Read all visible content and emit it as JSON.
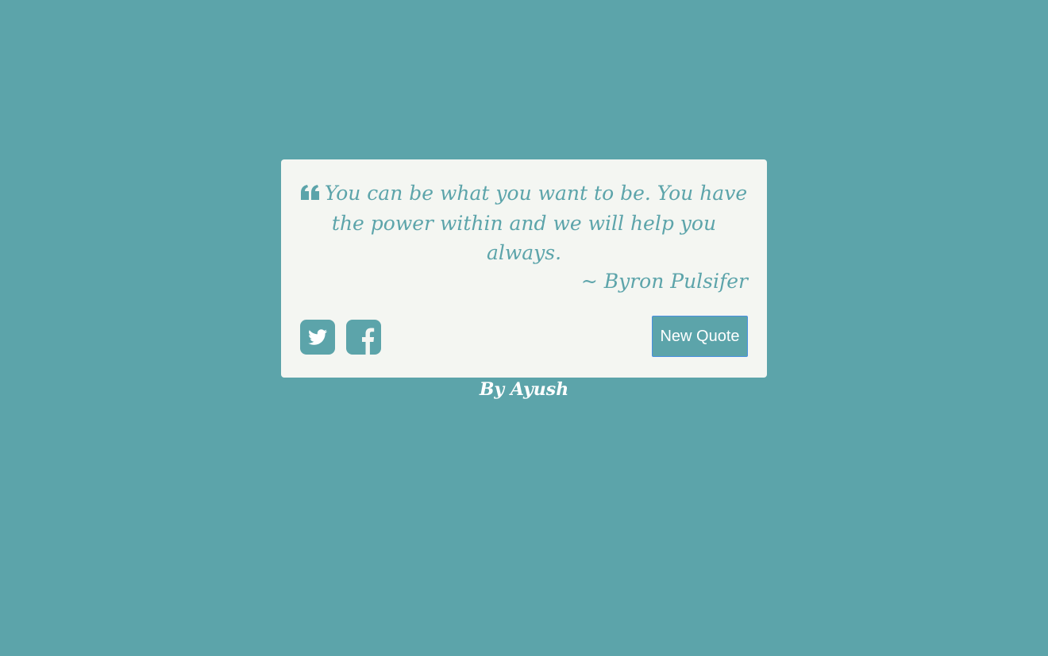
{
  "colors": {
    "background": "#5ca4aa",
    "card": "#f4f6f2",
    "accent": "#5ca4aa",
    "button_text": "#ffffff"
  },
  "quote": {
    "icon": "quote-left-icon",
    "text": "You can be what you want to be. You have the power within and we will help you always.",
    "author": "~ Byron Pulsifer"
  },
  "share": {
    "twitter_icon": "twitter-icon",
    "facebook_icon": "facebook-icon"
  },
  "actions": {
    "new_quote_label": "New Quote"
  },
  "footer": {
    "credit": "By Ayush"
  }
}
